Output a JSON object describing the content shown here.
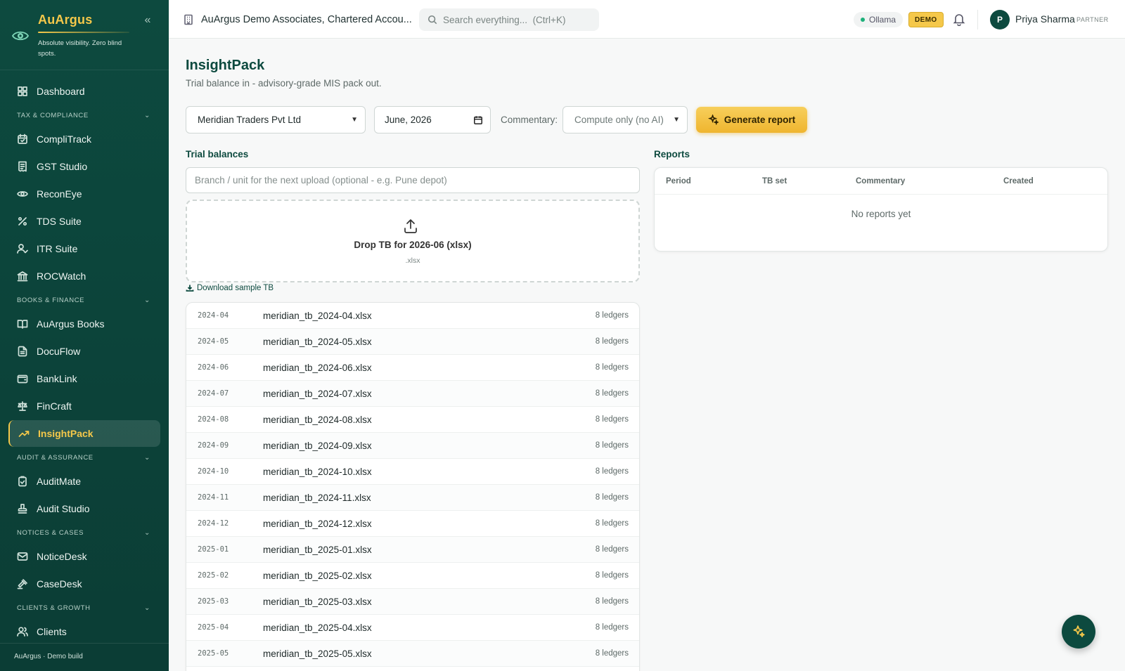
{
  "brand": {
    "name": "AuArgus",
    "tagline": "Absolute visibility. Zero blind spots.",
    "collapse_icon": "chevrons-left-icon"
  },
  "sidebar": {
    "dashboard": "Dashboard",
    "sections": [
      {
        "title": "TAX & COMPLIANCE",
        "items": [
          "CompliTrack",
          "GST Studio",
          "ReconEye",
          "TDS Suite",
          "ITR Suite",
          "ROCWatch"
        ]
      },
      {
        "title": "BOOKS & FINANCE",
        "items": [
          "AuArgus Books",
          "DocuFlow",
          "BankLink",
          "FinCraft",
          "InsightPack"
        ]
      },
      {
        "title": "AUDIT & ASSURANCE",
        "items": [
          "AuditMate",
          "Audit Studio"
        ]
      },
      {
        "title": "NOTICES & CASES",
        "items": [
          "NoticeDesk",
          "CaseDesk"
        ]
      },
      {
        "title": "CLIENTS & GROWTH",
        "items": [
          "Clients"
        ]
      }
    ],
    "active_item": "InsightPack",
    "footer": "AuArgus · Demo build"
  },
  "topbar": {
    "org_name": "AuArgus Demo Associates, Chartered Accou...",
    "search_placeholder": "Search everything...  (Ctrl+K)",
    "ollama": "Ollama",
    "demo_badge": "DEMO",
    "avatar_initial": "P",
    "user_name": "Priya Sharma",
    "user_role": "PARTNER"
  },
  "page": {
    "title": "InsightPack",
    "subtitle": "Trial balance in - advisory-grade MIS pack out."
  },
  "controls": {
    "company": "Meridian Traders Pvt Ltd",
    "period": "June, 2026",
    "commentary_label": "Commentary:",
    "commentary_value": "Compute only (no AI)",
    "generate_label": "Generate report"
  },
  "trial_balances": {
    "label": "Trial balances",
    "branch_placeholder": "Branch / unit for the next upload (optional - e.g. Pune depot)",
    "drop_title": "Drop TB for 2026-06 (xlsx)",
    "drop_sub": ".xlsx",
    "sample_link": "Download sample TB",
    "rows": [
      {
        "period": "2024-04",
        "file": "meridian_tb_2024-04.xlsx",
        "count": "8 ledgers"
      },
      {
        "period": "2024-05",
        "file": "meridian_tb_2024-05.xlsx",
        "count": "8 ledgers"
      },
      {
        "period": "2024-06",
        "file": "meridian_tb_2024-06.xlsx",
        "count": "8 ledgers"
      },
      {
        "period": "2024-07",
        "file": "meridian_tb_2024-07.xlsx",
        "count": "8 ledgers"
      },
      {
        "period": "2024-08",
        "file": "meridian_tb_2024-08.xlsx",
        "count": "8 ledgers"
      },
      {
        "period": "2024-09",
        "file": "meridian_tb_2024-09.xlsx",
        "count": "8 ledgers"
      },
      {
        "period": "2024-10",
        "file": "meridian_tb_2024-10.xlsx",
        "count": "8 ledgers"
      },
      {
        "period": "2024-11",
        "file": "meridian_tb_2024-11.xlsx",
        "count": "8 ledgers"
      },
      {
        "period": "2024-12",
        "file": "meridian_tb_2024-12.xlsx",
        "count": "8 ledgers"
      },
      {
        "period": "2025-01",
        "file": "meridian_tb_2025-01.xlsx",
        "count": "8 ledgers"
      },
      {
        "period": "2025-02",
        "file": "meridian_tb_2025-02.xlsx",
        "count": "8 ledgers"
      },
      {
        "period": "2025-03",
        "file": "meridian_tb_2025-03.xlsx",
        "count": "8 ledgers"
      },
      {
        "period": "2025-04",
        "file": "meridian_tb_2025-04.xlsx",
        "count": "8 ledgers"
      },
      {
        "period": "2025-05",
        "file": "meridian_tb_2025-05.xlsx",
        "count": "8 ledgers"
      }
    ]
  },
  "reports": {
    "label": "Reports",
    "columns": [
      "Period",
      "TB set",
      "Commentary",
      "Created"
    ],
    "empty": "No reports yet"
  },
  "colors": {
    "sidebar_bg": "#0d4a3f",
    "accent_gold": "#f5c84a",
    "text_primary": "#1f2a2a",
    "status_green": "#1db07a"
  }
}
